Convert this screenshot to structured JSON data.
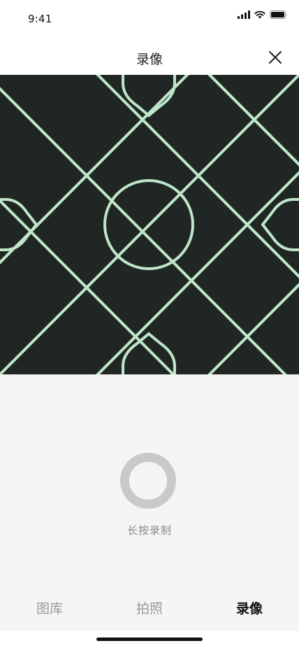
{
  "status_bar": {
    "time": "9:41",
    "icons": [
      "cellular-signal-icon",
      "wifi-icon",
      "battery-icon"
    ]
  },
  "nav": {
    "title": "录像",
    "close_icon": "close-icon"
  },
  "preview": {
    "pattern": "diagonal-lattice",
    "background_color": "#202624",
    "line_color": "#bfe6c9"
  },
  "recorder": {
    "hint": "长按录制",
    "button_color": "#c9c9c9"
  },
  "tabs": [
    {
      "label": "图库",
      "active": false
    },
    {
      "label": "拍照",
      "active": false
    },
    {
      "label": "录像",
      "active": true
    }
  ]
}
